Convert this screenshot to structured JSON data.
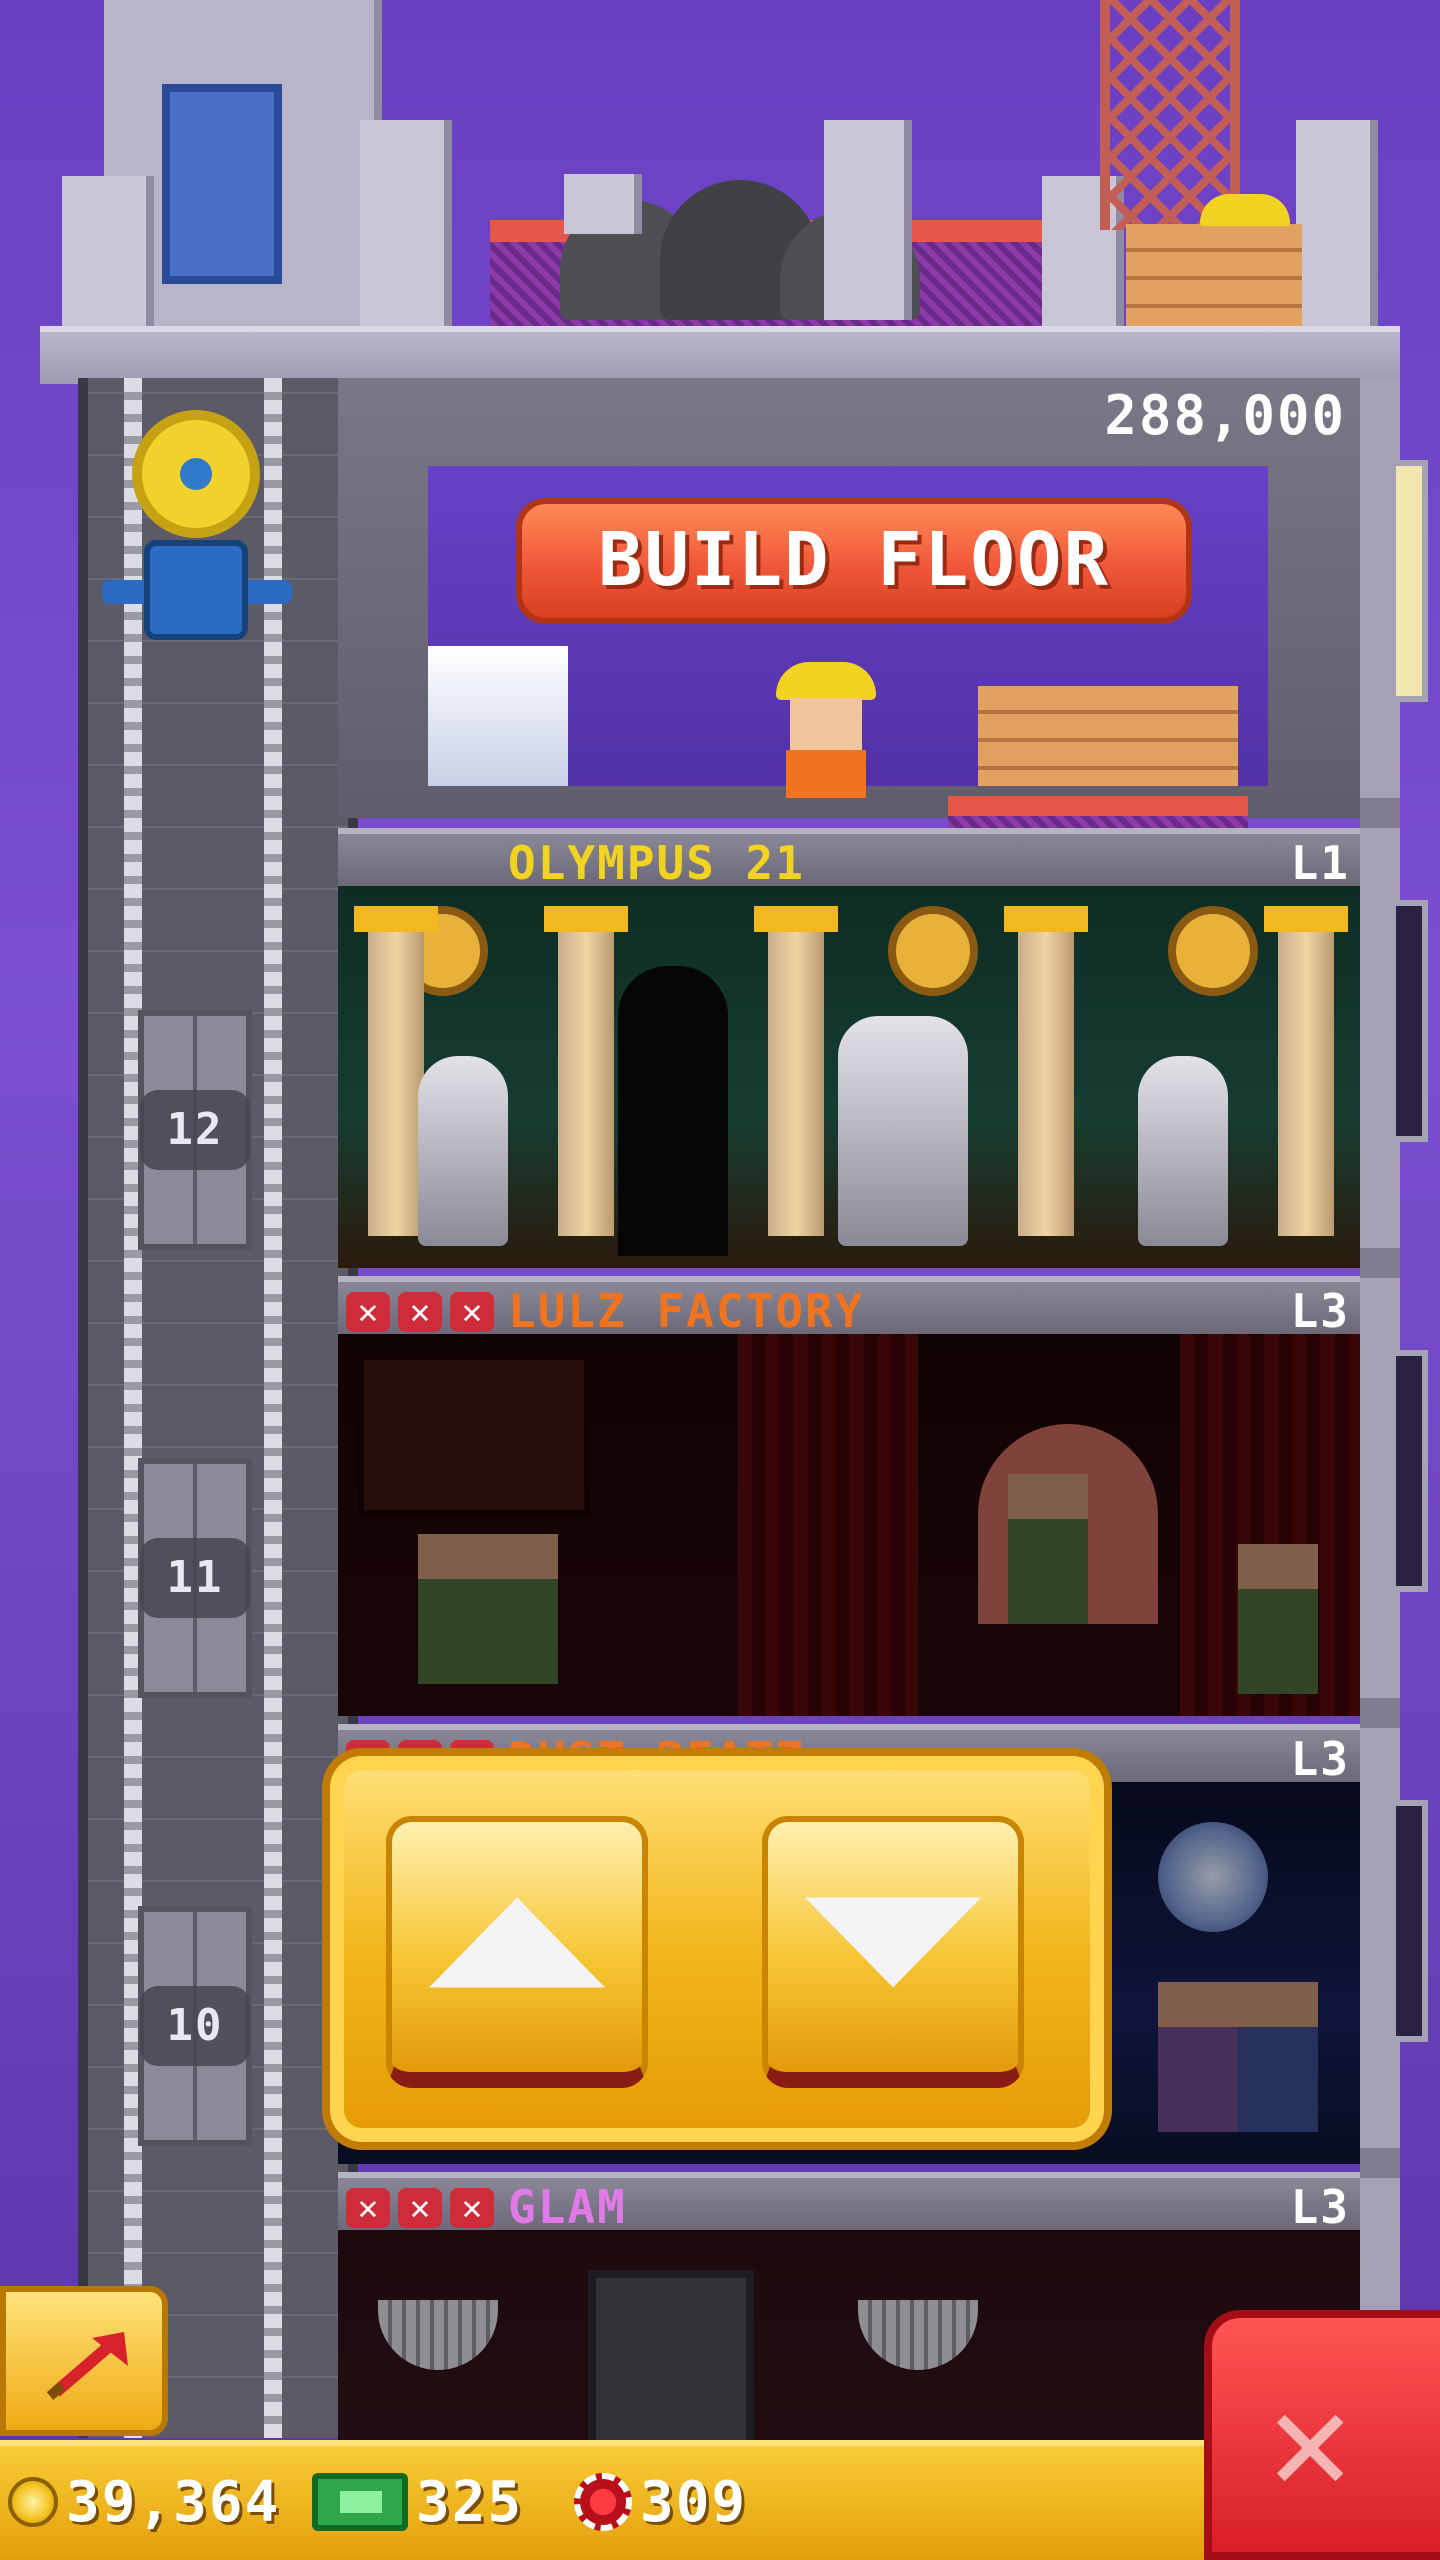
{
  "build_floor": {
    "price": "288,000",
    "button_label": "BUILD FLOOR"
  },
  "floors": [
    {
      "name": "OLYMPUS 21",
      "level": "L1",
      "name_color": "#f3d322",
      "number": "12",
      "unmet": 0
    },
    {
      "name": "LULZ FACTORY",
      "level": "L3",
      "name_color": "#f0731f",
      "number": "11",
      "unmet": 3
    },
    {
      "name": "DUST BEATZ",
      "level": "L3",
      "name_color": "#f0731f",
      "number": "10",
      "unmet": 3
    },
    {
      "name": "GLAM",
      "level": "L3",
      "name_color": "#e07ae6",
      "number": "",
      "unmet": 3
    }
  ],
  "currency": {
    "coins": "39,364",
    "bux": "325",
    "tickets": "309"
  },
  "icons": {
    "coin": "coin-icon",
    "bux": "bux-icon",
    "ticket": "chip-icon",
    "launch": "launch-arrow-icon",
    "close": "close-icon",
    "up": "up-arrow-icon",
    "down": "down-arrow-icon"
  },
  "colors": {
    "sky": "#6a3fc2",
    "gold": "#f2b61c",
    "build_button": "#f0573a",
    "close_button": "#d81e27"
  }
}
